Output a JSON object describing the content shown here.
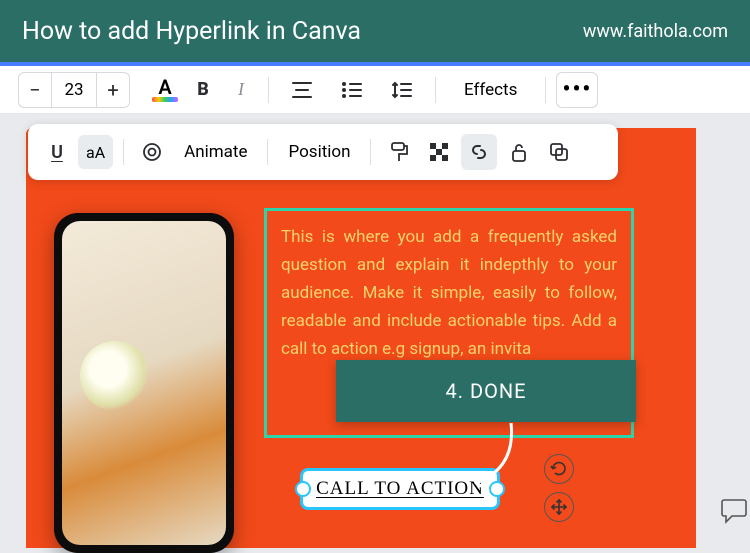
{
  "header": {
    "title": "How to add Hyperlink in Canva",
    "url": "www.faithola.com"
  },
  "toolbar1": {
    "font_size": "23",
    "effects_label": "Effects",
    "bold": "B",
    "italic": "I",
    "font_color_letter": "A",
    "more": "•••"
  },
  "toolbar2": {
    "underline": "U",
    "case": "aA",
    "animate": "Animate",
    "position": "Position"
  },
  "canvas": {
    "paragraph": "This is where you add a frequently asked question and explain it indepthly to your audience. Make it simple, easily to follow, readable and include actionable tips. Add a call to action e.g signup, an invita",
    "callout": "4. DONE",
    "cta": "CALL TO ACTION"
  },
  "icons": {
    "minus": "−",
    "plus": "+"
  }
}
